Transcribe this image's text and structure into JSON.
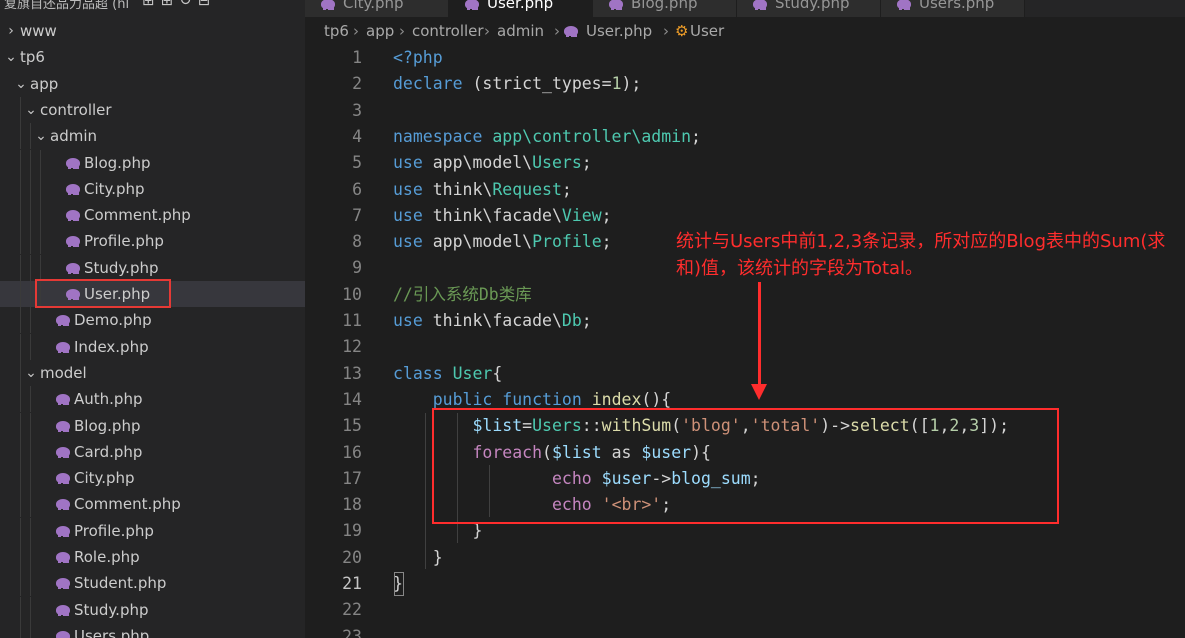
{
  "sidebar": {
    "header_title": "复旗自还品力品超 (hl",
    "tree": [
      {
        "label": "www",
        "kind": "folder",
        "expanded": false,
        "depth": 0
      },
      {
        "label": "tp6",
        "kind": "folder",
        "expanded": true,
        "depth": 0
      },
      {
        "label": "app",
        "kind": "folder",
        "expanded": true,
        "depth": 1
      },
      {
        "label": "controller",
        "kind": "folder",
        "expanded": true,
        "depth": 2
      },
      {
        "label": "admin",
        "kind": "folder",
        "expanded": true,
        "depth": 3
      },
      {
        "label": "Blog.php",
        "kind": "file",
        "depth": 4
      },
      {
        "label": "City.php",
        "kind": "file",
        "depth": 4
      },
      {
        "label": "Comment.php",
        "kind": "file",
        "depth": 4
      },
      {
        "label": "Profile.php",
        "kind": "file",
        "depth": 4
      },
      {
        "label": "Study.php",
        "kind": "file",
        "depth": 4
      },
      {
        "label": "User.php",
        "kind": "file",
        "depth": 4,
        "selected": true
      },
      {
        "label": "Demo.php",
        "kind": "file",
        "depth": 3
      },
      {
        "label": "Index.php",
        "kind": "file",
        "depth": 3
      },
      {
        "label": "model",
        "kind": "folder",
        "expanded": true,
        "depth": 2
      },
      {
        "label": "Auth.php",
        "kind": "file",
        "depth": 3
      },
      {
        "label": "Blog.php",
        "kind": "file",
        "depth": 3
      },
      {
        "label": "Card.php",
        "kind": "file",
        "depth": 3
      },
      {
        "label": "City.php",
        "kind": "file",
        "depth": 3
      },
      {
        "label": "Comment.php",
        "kind": "file",
        "depth": 3
      },
      {
        "label": "Profile.php",
        "kind": "file",
        "depth": 3
      },
      {
        "label": "Role.php",
        "kind": "file",
        "depth": 3
      },
      {
        "label": "Student.php",
        "kind": "file",
        "depth": 3
      },
      {
        "label": "Study.php",
        "kind": "file",
        "depth": 3
      },
      {
        "label": "Users.php",
        "kind": "file",
        "depth": 3
      }
    ]
  },
  "tabs": [
    {
      "label": "City.php",
      "active": false
    },
    {
      "label": "User.php",
      "active": true
    },
    {
      "label": "Blog.php",
      "active": false
    },
    {
      "label": "Study.php",
      "active": false
    },
    {
      "label": "Users.php",
      "active": false
    }
  ],
  "breadcrumb": {
    "parts": [
      "tp6",
      "app",
      "controller",
      "admin",
      "User.php",
      "User"
    ]
  },
  "editor": {
    "current_line": 21,
    "lines": [
      {
        "n": "1",
        "tokens": [
          [
            "kw",
            "<?php"
          ]
        ]
      },
      {
        "n": "2",
        "tokens": [
          [
            "kw",
            "declare"
          ],
          [
            "plain",
            " (strict_types="
          ],
          [
            "num",
            "1"
          ],
          [
            "plain",
            ");"
          ]
        ]
      },
      {
        "n": "3",
        "tokens": []
      },
      {
        "n": "4",
        "tokens": [
          [
            "kw",
            "namespace"
          ],
          [
            "plain",
            " "
          ],
          [
            "ty",
            "app\\controller\\admin"
          ],
          [
            "plain",
            ";"
          ]
        ]
      },
      {
        "n": "5",
        "tokens": [
          [
            "kw",
            "use"
          ],
          [
            "plain",
            " app\\model\\"
          ],
          [
            "ty",
            "Users"
          ],
          [
            "plain",
            ";"
          ]
        ]
      },
      {
        "n": "6",
        "tokens": [
          [
            "kw",
            "use"
          ],
          [
            "plain",
            " think\\"
          ],
          [
            "ty",
            "Request"
          ],
          [
            "plain",
            ";"
          ]
        ]
      },
      {
        "n": "7",
        "tokens": [
          [
            "kw",
            "use"
          ],
          [
            "plain",
            " think\\facade\\"
          ],
          [
            "ty",
            "View"
          ],
          [
            "plain",
            ";"
          ]
        ]
      },
      {
        "n": "8",
        "tokens": [
          [
            "kw",
            "use"
          ],
          [
            "plain",
            " app\\model\\"
          ],
          [
            "ty",
            "Profile"
          ],
          [
            "plain",
            ";"
          ]
        ]
      },
      {
        "n": "9",
        "tokens": []
      },
      {
        "n": "10",
        "tokens": [
          [
            "cmt",
            "//引入系统Db类库"
          ]
        ]
      },
      {
        "n": "11",
        "tokens": [
          [
            "kw",
            "use"
          ],
          [
            "plain",
            " think\\facade\\"
          ],
          [
            "ty",
            "Db"
          ],
          [
            "plain",
            ";"
          ]
        ]
      },
      {
        "n": "12",
        "tokens": []
      },
      {
        "n": "13",
        "tokens": [
          [
            "kw",
            "class"
          ],
          [
            "plain",
            " "
          ],
          [
            "ty",
            "User"
          ],
          [
            "plain",
            "{"
          ]
        ]
      },
      {
        "n": "14",
        "tokens": [
          [
            "plain",
            "    "
          ],
          [
            "kw",
            "public"
          ],
          [
            "plain",
            " "
          ],
          [
            "kw",
            "function"
          ],
          [
            "plain",
            " "
          ],
          [
            "fn",
            "index"
          ],
          [
            "plain",
            "(){"
          ]
        ]
      },
      {
        "n": "15",
        "tokens": [
          [
            "plain",
            "        "
          ],
          [
            "var",
            "$list"
          ],
          [
            "plain",
            "="
          ],
          [
            "ty",
            "Users"
          ],
          [
            "plain",
            "::"
          ],
          [
            "fn",
            "withSum"
          ],
          [
            "plain",
            "("
          ],
          [
            "str",
            "'blog'"
          ],
          [
            "plain",
            ","
          ],
          [
            "str",
            "'total'"
          ],
          [
            "plain",
            ")->"
          ],
          [
            "fn",
            "select"
          ],
          [
            "plain",
            "(["
          ],
          [
            "num",
            "1"
          ],
          [
            "plain",
            ","
          ],
          [
            "num",
            "2"
          ],
          [
            "plain",
            ","
          ],
          [
            "num",
            "3"
          ],
          [
            "plain",
            "]);"
          ]
        ]
      },
      {
        "n": "16",
        "tokens": [
          [
            "plain",
            "        "
          ],
          [
            "kw2",
            "foreach"
          ],
          [
            "plain",
            "("
          ],
          [
            "var",
            "$list"
          ],
          [
            "plain",
            " as "
          ],
          [
            "var",
            "$user"
          ],
          [
            "plain",
            "){"
          ]
        ]
      },
      {
        "n": "17",
        "tokens": [
          [
            "plain",
            "                "
          ],
          [
            "kw2",
            "echo"
          ],
          [
            "plain",
            " "
          ],
          [
            "var",
            "$user"
          ],
          [
            "plain",
            "->"
          ],
          [
            "var",
            "blog_sum"
          ],
          [
            "plain",
            ";"
          ]
        ]
      },
      {
        "n": "18",
        "tokens": [
          [
            "plain",
            "                "
          ],
          [
            "kw2",
            "echo"
          ],
          [
            "plain",
            " "
          ],
          [
            "str",
            "'<br>'"
          ],
          [
            "plain",
            ";"
          ]
        ]
      },
      {
        "n": "19",
        "tokens": [
          [
            "plain",
            "        }"
          ]
        ]
      },
      {
        "n": "20",
        "tokens": [
          [
            "plain",
            "    }"
          ]
        ]
      },
      {
        "n": "21",
        "tokens": [
          [
            "plain",
            "}"
          ]
        ]
      },
      {
        "n": "22",
        "tokens": []
      },
      {
        "n": "23",
        "tokens": []
      }
    ]
  },
  "annotation": {
    "text": "统计与Users中前1,2,3条记录，所对应的Blog表中的Sum(求和)值，该统计的字段为Total。",
    "color": "#ff2d2d"
  },
  "colors": {
    "background": "#1e1e1e",
    "sidebar": "#252526",
    "selected_row": "#37373d",
    "php_icon": "#a074c4",
    "highlight_red": "#e53935"
  }
}
